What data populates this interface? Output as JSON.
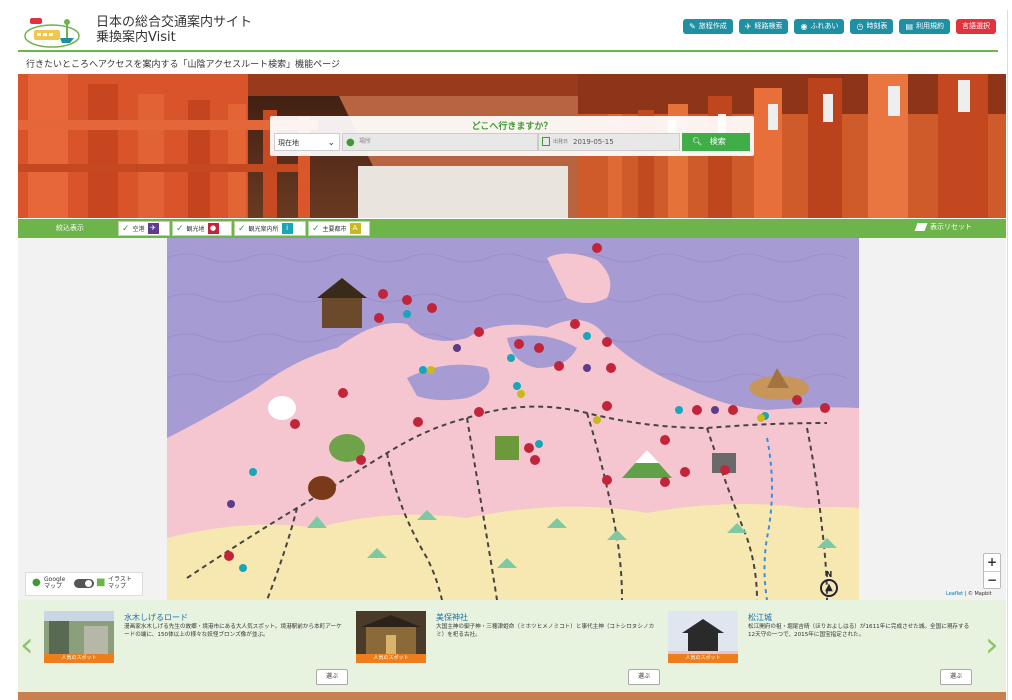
{
  "header": {
    "site_title_line1": "日本の総合交通案内サイト",
    "site_title_line2": "乗換案内Visit",
    "buttons": [
      {
        "label": "旅程作成",
        "icon": "pencil-icon"
      },
      {
        "label": "経路検索",
        "icon": "plane-icon"
      },
      {
        "label": "ふれあい",
        "icon": "bus-icon"
      },
      {
        "label": "時刻表",
        "icon": "clock-icon"
      },
      {
        "label": "利用規約",
        "icon": "document-icon"
      },
      {
        "label": "言語選択",
        "icon": ""
      }
    ]
  },
  "subbar": {
    "text": "行きたいところへアクセスを案内する「山陰アクセスルート検索」機能ページ"
  },
  "search": {
    "title": "どこへ行きますか？",
    "origin_select": "現在地",
    "place_placeholder": "場所",
    "date_label": "出発日",
    "date_value": "2019-05-15",
    "search_label": "検索"
  },
  "filter": {
    "label": "絞込表示",
    "items": [
      {
        "label": "空港",
        "icon": "plane-icon",
        "color": "#5b3d8a"
      },
      {
        "label": "観光地",
        "icon": "map-pin-icon",
        "color": "#c2253a"
      },
      {
        "label": "観光案内所",
        "icon": "info-icon",
        "color": "#1aa5b8"
      },
      {
        "label": "主要都市",
        "icon": "city-icon",
        "color": "#c8b91e"
      }
    ],
    "reset_label": "表示リセット"
  },
  "map": {
    "toggle_left_line1": "Google",
    "toggle_left_line2": "マップ",
    "toggle_right_line1": "イラスト",
    "toggle_right_line2": "マップ",
    "zoom_in": "+",
    "zoom_out": "−",
    "north": "N",
    "attribution_a": "Leaflet",
    "attribution_b": " | © Mapbit"
  },
  "carousel": {
    "badge": "人気のスポット",
    "select_label": "選ぶ",
    "cards": [
      {
        "title": "水木しげるロード",
        "desc": "漫画家水木しげる先生の故郷・境港市にある大人気スポット。境港駅前から本町アーケードの端に、150体以上の様々な妖怪ブロンズ像が並ぶ。"
      },
      {
        "title": "美保神社",
        "desc": "大国主神の御子神・三穂津姫命（ミホツヒメノミコト）と事代主神（コトシロヌシノカミ）を祀る古社。"
      },
      {
        "title": "松江城",
        "desc": "松江開府の祖・堀尾吉晴（ほりおよしはる）が1611年に完成させた城。全国に現存する12天守の一つで、2015年に国宝指定された。"
      }
    ]
  },
  "colors": {
    "accent_green": "#6db44a",
    "teal": "#1f8fa3",
    "red": "#e2323c",
    "sea": "#a79bd3",
    "land": "#f6c6d0"
  }
}
